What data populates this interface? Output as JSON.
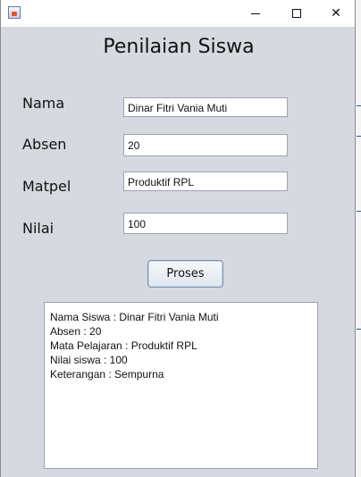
{
  "window": {
    "title_icon": "java-app-icon",
    "controls": [
      "minimize-icon",
      "maximize-icon",
      "close-icon"
    ]
  },
  "heading": "Penilaian Siswa",
  "form": {
    "nama_label": "Nama",
    "nama_value": "Dinar Fitri Vania Muti",
    "absen_label": "Absen",
    "absen_value": "20",
    "matpel_label": "Matpel",
    "matpel_value": "Produktif RPL",
    "nilai_label": "Nilai",
    "nilai_value": "100"
  },
  "button": {
    "label": "Proses"
  },
  "output": {
    "lines": [
      "Nama Siswa : Dinar Fitri Vania Muti",
      "Absen : 20",
      "Mata Pelajaran : Produktif RPL",
      "Nilai siswa : 100",
      "Keterangan : Sempurna"
    ]
  },
  "colors": {
    "window_bg": "#d6d9df",
    "titlebar_bg": "#ffffff",
    "button_border": "#7b94b0"
  }
}
